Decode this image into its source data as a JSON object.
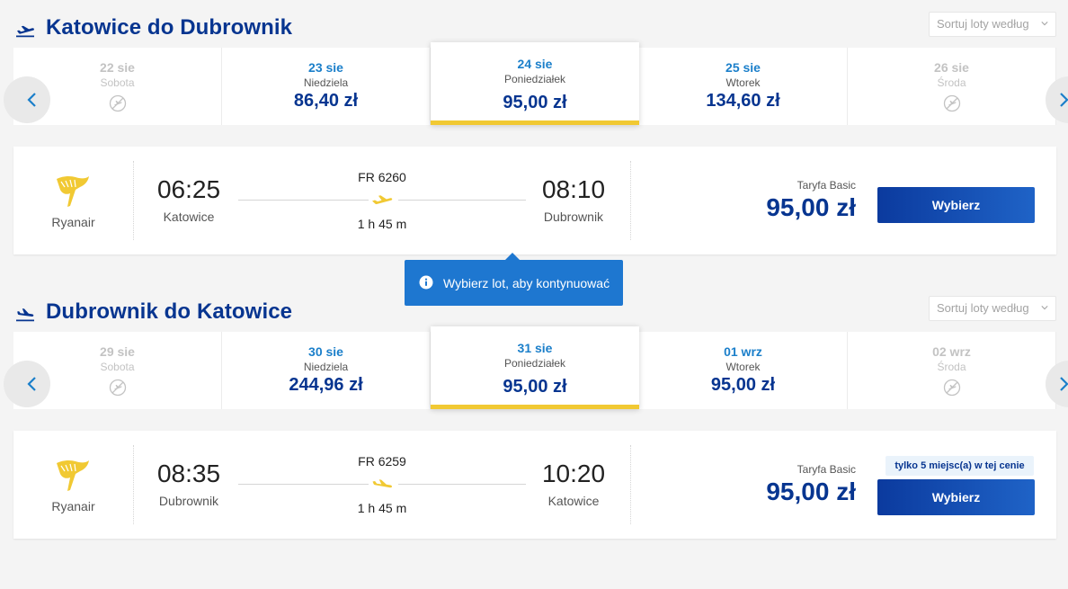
{
  "outbound": {
    "title": "Katowice do Dubrownik",
    "sort_label": "Sortuj loty według",
    "dates": [
      {
        "date": "22 sie",
        "day": "Sobota",
        "price": "",
        "available": false
      },
      {
        "date": "23 sie",
        "day": "Niedziela",
        "price": "86,40 zł",
        "available": true
      },
      {
        "date": "24 sie",
        "day": "Poniedziałek",
        "price": "95,00 zł",
        "available": true,
        "selected": true
      },
      {
        "date": "25 sie",
        "day": "Wtorek",
        "price": "134,60 zł",
        "available": true
      },
      {
        "date": "26 sie",
        "day": "Środa",
        "price": "",
        "available": false
      }
    ],
    "flight": {
      "airline": "Ryanair",
      "dep_time": "06:25",
      "dep_city": "Katowice",
      "flight_no": "FR 6260",
      "duration": "1 h 45 m",
      "arr_time": "08:10",
      "arr_city": "Dubrownik",
      "fare_label": "Taryfa Basic",
      "price": "95,00 zł",
      "select_label": "Wybierz"
    }
  },
  "tooltip": {
    "text": "Wybierz lot, aby kontynuować"
  },
  "inbound": {
    "title": "Dubrownik do Katowice",
    "sort_label": "Sortuj loty według",
    "dates": [
      {
        "date": "29 sie",
        "day": "Sobota",
        "price": "",
        "available": false
      },
      {
        "date": "30 sie",
        "day": "Niedziela",
        "price": "244,96 zł",
        "available": true
      },
      {
        "date": "31 sie",
        "day": "Poniedziałek",
        "price": "95,00 zł",
        "available": true,
        "selected": true
      },
      {
        "date": "01 wrz",
        "day": "Wtorek",
        "price": "95,00 zł",
        "available": true
      },
      {
        "date": "02 wrz",
        "day": "Środa",
        "price": "",
        "available": false
      }
    ],
    "flight": {
      "airline": "Ryanair",
      "dep_time": "08:35",
      "dep_city": "Dubrownik",
      "flight_no": "FR 6259",
      "duration": "1 h 45 m",
      "arr_time": "10:20",
      "arr_city": "Katowice",
      "fare_label": "Taryfa Basic",
      "price": "95,00 zł",
      "seats_badge": "tylko 5 miejsc(a) w tej cenie",
      "select_label": "Wybierz"
    }
  },
  "colors": {
    "brand_blue": "#073590",
    "accent_yellow": "#f1c933",
    "date_blue": "#1b7fca",
    "tooltip_blue": "#1e77d0"
  }
}
